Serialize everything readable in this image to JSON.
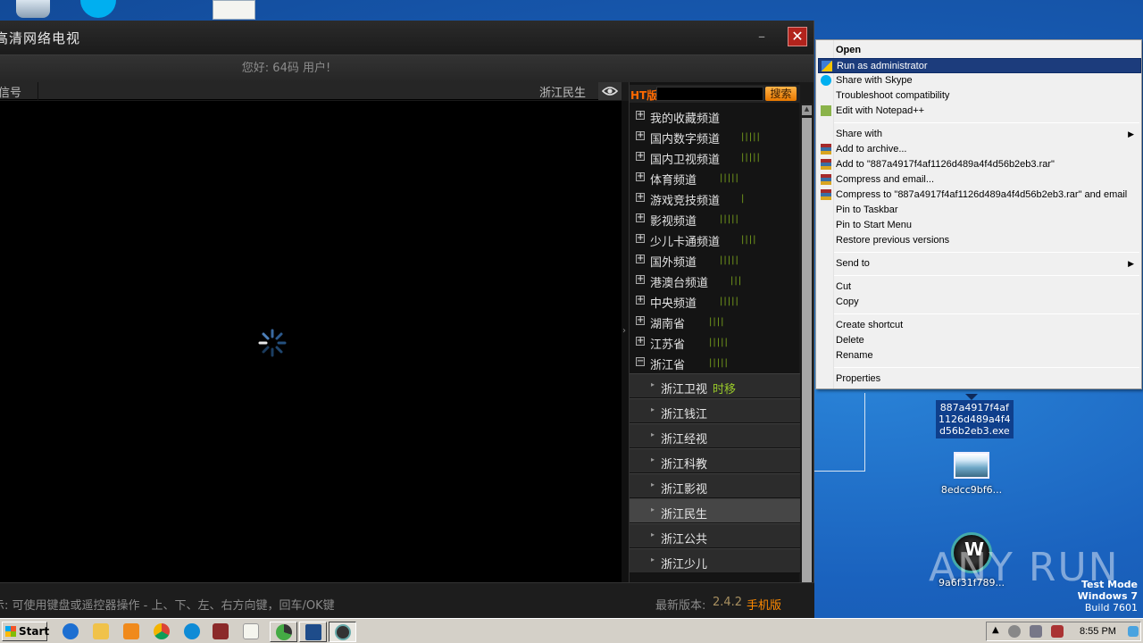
{
  "app": {
    "title": "高清网络电视",
    "greeting": "您好: 64码 用户!",
    "signal_label": "信号",
    "current_channel": "浙江民生",
    "hint": "示:  可使用键盘或遥控器操作 - 上、下、左、右方向键，回车/OK键",
    "version_label": "最新版本:",
    "version": "2.4.2",
    "mobile_link": "手机版",
    "search": {
      "prefix": "HT版",
      "placeholder": "",
      "button": "搜索"
    },
    "categories": [
      {
        "name": "我的收藏频道",
        "bars": "",
        "expanded": false
      },
      {
        "name": "国内数字频道",
        "bars": "|||||",
        "expanded": false
      },
      {
        "name": "国内卫视频道",
        "bars": "|||||",
        "expanded": false
      },
      {
        "name": "体育频道",
        "bars": "|||||",
        "expanded": false
      },
      {
        "name": "游戏竞技频道",
        "bars": "|",
        "expanded": false
      },
      {
        "name": "影视频道",
        "bars": "|||||",
        "expanded": false
      },
      {
        "name": "少儿卡通频道",
        "bars": "||||",
        "expanded": false
      },
      {
        "name": "国外频道",
        "bars": "|||||",
        "expanded": false
      },
      {
        "name": "港澳台频道",
        "bars": "|||",
        "expanded": false
      },
      {
        "name": "中央频道",
        "bars": "|||||",
        "expanded": false
      },
      {
        "name": "湖南省",
        "bars": "||||",
        "expanded": false
      },
      {
        "name": "江苏省",
        "bars": "|||||",
        "expanded": false
      },
      {
        "name": "浙江省",
        "bars": "|||||",
        "expanded": true
      }
    ],
    "sub_channels": [
      {
        "name": "浙江卫视",
        "tag": "时移"
      },
      {
        "name": "浙江钱江",
        "tag": ""
      },
      {
        "name": "浙江经视",
        "tag": ""
      },
      {
        "name": "浙江科教",
        "tag": ""
      },
      {
        "name": "浙江影视",
        "tag": ""
      },
      {
        "name": "浙江民生",
        "tag": ""
      },
      {
        "name": "浙江公共",
        "tag": ""
      },
      {
        "name": "浙江少儿",
        "tag": ""
      }
    ],
    "active_sub_channel": 5
  },
  "context_menu": {
    "items": [
      {
        "label": "Open",
        "bold": true,
        "icon": ""
      },
      {
        "label": "Run as administrator",
        "highlighted": true,
        "icon": "uac-shield-icon"
      },
      {
        "label": "Share with Skype",
        "icon": "skype-icon"
      },
      {
        "label": "Troubleshoot compatibility",
        "icon": ""
      },
      {
        "label": "Edit with Notepad++",
        "icon": "notepad-icon"
      },
      {
        "label": "Share with",
        "icon": "",
        "submenu": true
      },
      {
        "label": "Add to archive...",
        "icon": "winrar-icon"
      },
      {
        "label": "Add to \"887a4917f4af1126d489a4f4d56b2eb3.rar\"",
        "icon": "winrar-icon"
      },
      {
        "label": "Compress and email...",
        "icon": "winrar-icon"
      },
      {
        "label": "Compress to \"887a4917f4af1126d489a4f4d56b2eb3.rar\" and email",
        "icon": "winrar-icon"
      },
      {
        "label": "Pin to Taskbar",
        "icon": ""
      },
      {
        "label": "Pin to Start Menu",
        "icon": ""
      },
      {
        "label": "Restore previous versions",
        "icon": ""
      },
      {
        "label": "Send to",
        "icon": "",
        "submenu": true
      },
      {
        "label": "Cut",
        "icon": ""
      },
      {
        "label": "Copy",
        "icon": ""
      },
      {
        "label": "Create shortcut",
        "icon": ""
      },
      {
        "label": "Delete",
        "icon": ""
      },
      {
        "label": "Rename",
        "icon": ""
      },
      {
        "label": "Properties",
        "icon": ""
      }
    ]
  },
  "desktop": {
    "exe_icon_label": "887a4917f4af1126d489a4f4d56b2eb3.exe",
    "exe_label_lines": [
      "887a4917f4af",
      "1126d489a4f4",
      "d56b2eb3.exe"
    ],
    "image_icon_label": "8edcc9bf6...",
    "dll_icon_label": "9a6f31f789...",
    "watermark": "ANY RUN",
    "test_mode": [
      "Test Mode",
      "Windows 7",
      "Build 7601"
    ]
  },
  "taskbar": {
    "start_label": "Start",
    "clock": "8:55 PM"
  },
  "colors": {
    "accent_orange": "#ff8a00",
    "signal_green": "#7aa41c",
    "menu_highlight": "#1c3c7c",
    "close_red": "#b2231c"
  }
}
